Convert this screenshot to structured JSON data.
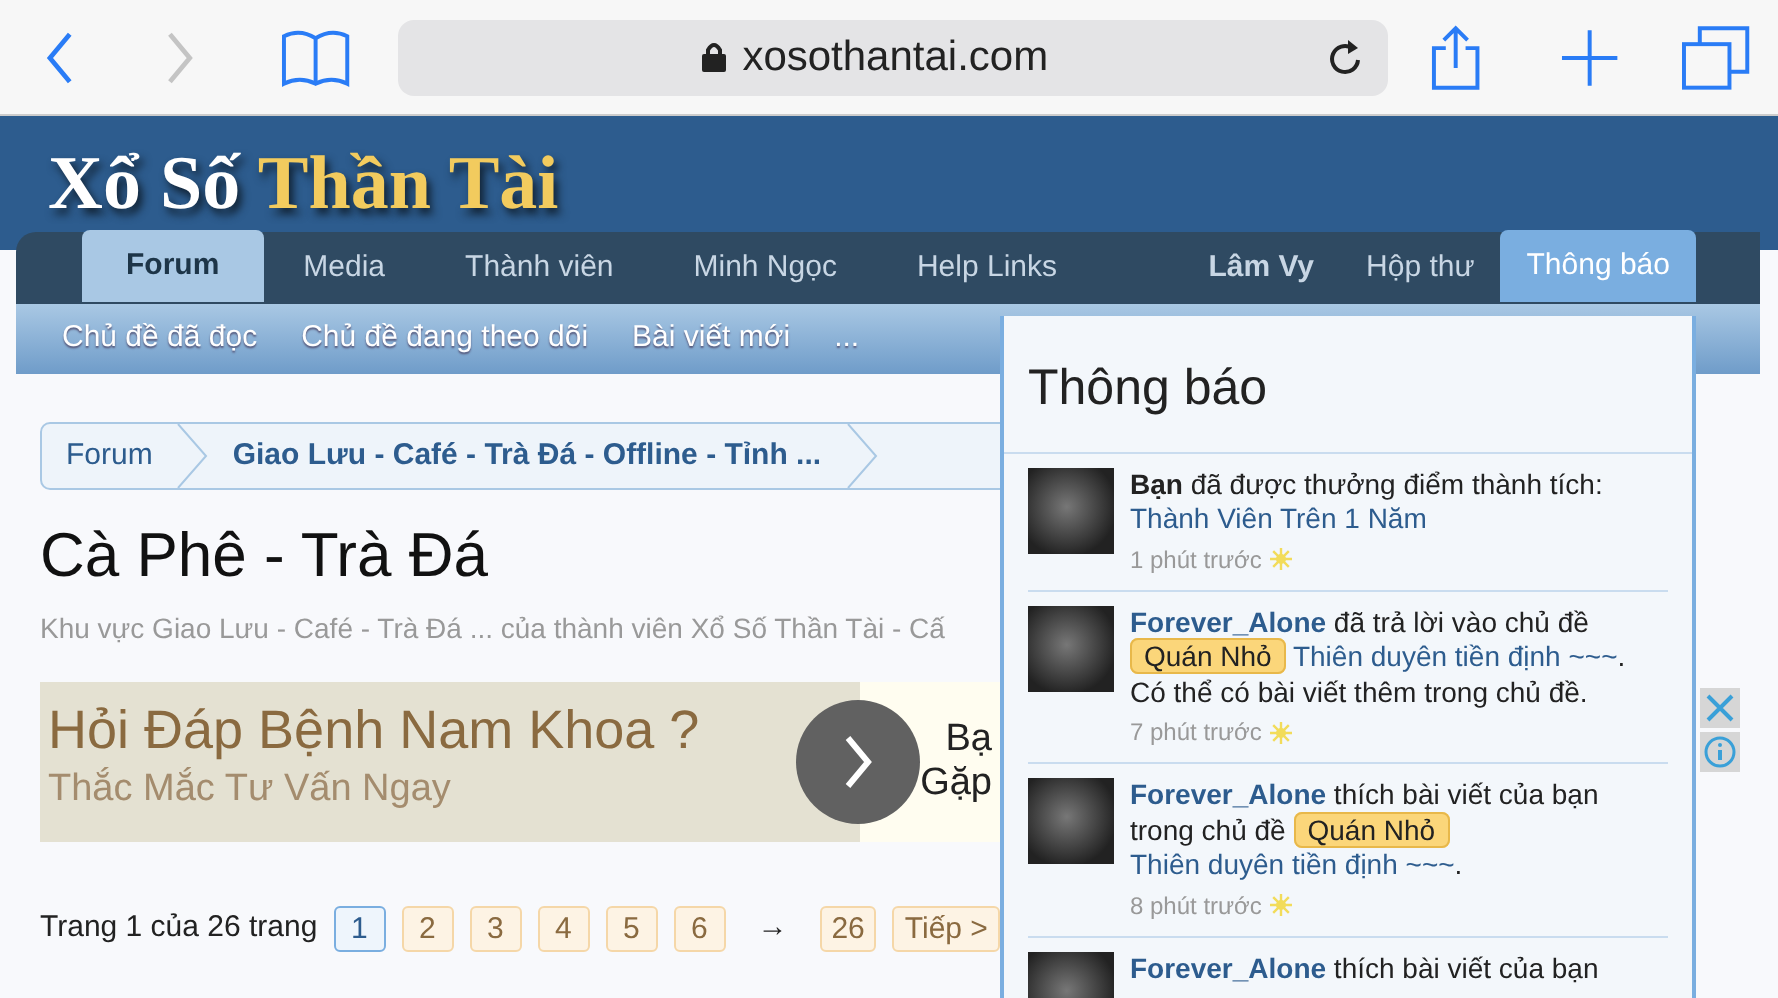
{
  "browser": {
    "back": {
      "disabled": false
    },
    "forward": {
      "disabled": true
    },
    "url": "xosothantai.com"
  },
  "logo": {
    "first": "Xổ Số",
    "second": "Thần Tài"
  },
  "tabs": [
    {
      "label": "Forum",
      "selected": true
    },
    {
      "label": "Media",
      "selected": false
    },
    {
      "label": "Thành viên",
      "selected": false
    },
    {
      "label": "Minh Ngọc",
      "selected": false
    },
    {
      "label": "Help Links",
      "selected": false
    }
  ],
  "user_tabs": [
    {
      "label": "Lâm Vy",
      "kind": "user",
      "selected": false
    },
    {
      "label": "Hộp thư",
      "kind": "link",
      "selected": false
    },
    {
      "label": "Thông báo",
      "kind": "link",
      "selected": true
    }
  ],
  "subnav": [
    "Chủ đề đã đọc",
    "Chủ đề đang theo dõi",
    "Bài viết mới",
    "..."
  ],
  "breadcrumb": [
    {
      "label": "Forum",
      "current": false
    },
    {
      "label": "Giao Lưu - Café - Trà Đá - Offline - Tỉnh ...",
      "current": true
    }
  ],
  "page": {
    "title": "Cà Phê - Trà Đá",
    "description": "Khu vực Giao Lưu - Café - Trà Đá ... của thành viên Xổ Số Thần Tài - Cấ"
  },
  "ad": {
    "title": "Hỏi Đáp Bệnh Nam Khoa ?",
    "subtitle": "Thắc Mắc Tư Vấn Ngay",
    "side_lines": [
      "Bạ",
      "Gặp"
    ]
  },
  "pagination": {
    "label": "Trang 1 của 26 trang",
    "pages": [
      {
        "label": "1",
        "selected": true
      },
      {
        "label": "2",
        "selected": false
      },
      {
        "label": "3",
        "selected": false
      },
      {
        "label": "4",
        "selected": false
      },
      {
        "label": "5",
        "selected": false
      },
      {
        "label": "6",
        "selected": false
      }
    ],
    "arrow": "→",
    "last": "26",
    "next": "Tiếp >"
  },
  "notifications": {
    "title": "Thông báo",
    "items": [
      {
        "actor": "Bạn",
        "actor_link": false,
        "action": "đã được thưởng điểm thành tích:",
        "link": "Thành Viên Trên 1 Năm",
        "time": "1 phút trước"
      },
      {
        "actor": "Forever_Alone",
        "actor_link": true,
        "action": "đã trả lời vào chủ đề",
        "prefix": "Quán Nhỏ",
        "link": "Thiên duyên tiền định ~~~",
        "tail": ". Có thể có bài viết thêm trong chủ đề.",
        "time": "7 phút trước"
      },
      {
        "actor": "Forever_Alone",
        "actor_link": true,
        "action": "thích bài viết của bạn trong chủ đề",
        "prefix": "Quán Nhỏ",
        "link": "Thiên duyên tiền định ~~~",
        "tail": ".",
        "time": "8 phút trước"
      },
      {
        "actor": "Forever_Alone",
        "actor_link": true,
        "action": "thích bài viết của bạn"
      }
    ]
  }
}
